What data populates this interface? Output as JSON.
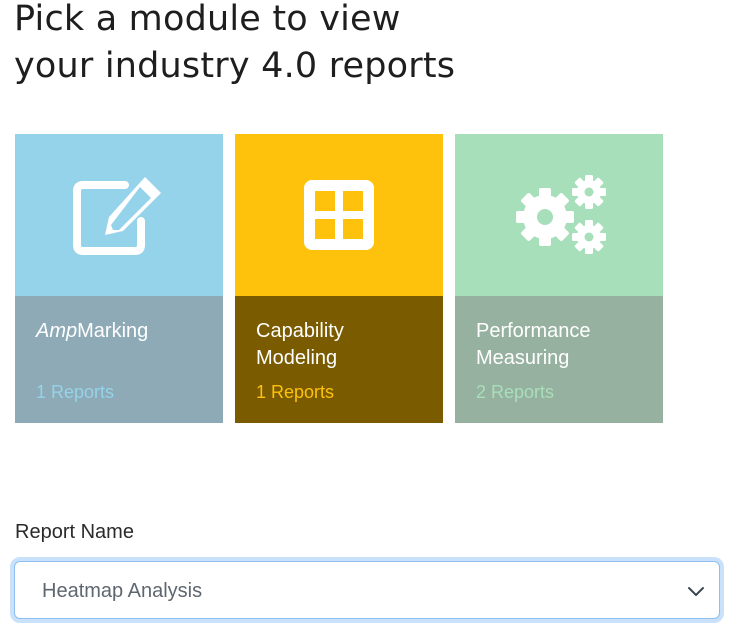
{
  "heading": {
    "line1": "Pick a module to view",
    "line2": "your industry 4.0 reports"
  },
  "modules": [
    {
      "name_italic": "Amp",
      "name_rest": "Marking",
      "count": "1 Reports",
      "icon": "edit-icon",
      "top_color": "#95d3ea",
      "bottom_color": "#8daab6"
    },
    {
      "name_line1": "Capability",
      "name_line2": "Modeling",
      "count": "1 Reports",
      "icon": "grid-icon",
      "top_color": "#fec20d",
      "bottom_color": "#7a5b00"
    },
    {
      "name_line1": "Performance",
      "name_line2": "Measuring",
      "count": "2 Reports",
      "icon": "gears-icon",
      "top_color": "#a8dfbb",
      "bottom_color": "#96b19f"
    }
  ],
  "report_select": {
    "label": "Report Name",
    "value": "Heatmap Analysis",
    "icon": "chevron-down-icon"
  }
}
